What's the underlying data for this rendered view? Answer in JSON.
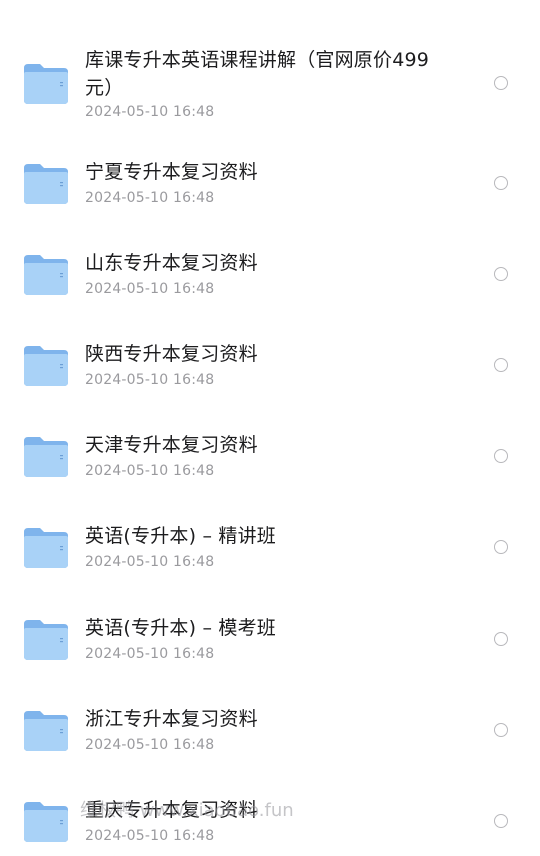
{
  "files": [
    {
      "name": "库课专升本英语课程讲解（官网原价499元）",
      "date": "2024-05-10 16:48"
    },
    {
      "name": "宁夏专升本复习资料",
      "date": "2024-05-10 16:48"
    },
    {
      "name": "山东专升本复习资料",
      "date": "2024-05-10 16:48"
    },
    {
      "name": "陕西专升本复习资料",
      "date": "2024-05-10 16:48"
    },
    {
      "name": "天津专升本复习资料",
      "date": "2024-05-10 16:48"
    },
    {
      "name": "英语(专升本) – 精讲班",
      "date": "2024-05-10 16:48"
    },
    {
      "name": "英语(专升本) – 模考班",
      "date": "2024-05-10 16:48"
    },
    {
      "name": "浙江专升本复习资料",
      "date": "2024-05-10 16:48"
    },
    {
      "name": "重庆专升本复习资料",
      "date": "2024-05-10 16:48"
    }
  ],
  "watermark": "维权鸭 www.xiaobao.fun",
  "icons": {
    "folder": "folder-icon",
    "select": "radio-unchecked-icon"
  },
  "colors": {
    "folder_front": "#a9d2f7",
    "folder_back": "#7fb4ec",
    "name": "#1c1c1e",
    "date": "#9a9a9e",
    "radio": "#b8b8bc"
  }
}
